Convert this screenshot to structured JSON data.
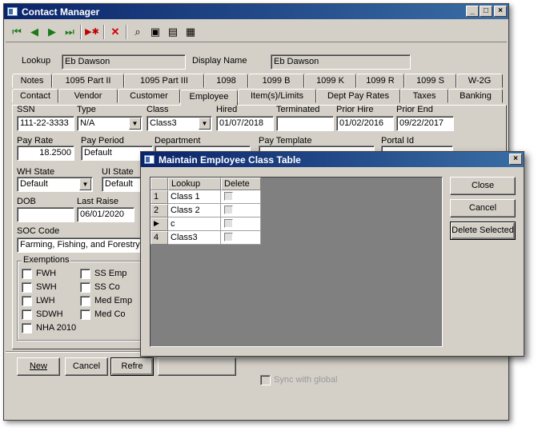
{
  "main_window": {
    "title": "Contact Manager",
    "toolbar": {
      "first_icon": "first-record-icon",
      "prev_icon": "prev-record-icon",
      "next_icon": "next-record-icon",
      "last_icon": "last-record-icon",
      "new_icon": "new-record-icon",
      "delete_icon": "delete-icon",
      "find_icon": "find-icon",
      "save_icon": "save-icon",
      "save_close_icon": "save-close-icon",
      "properties_icon": "properties-icon"
    },
    "lookup_label": "Lookup",
    "lookup_value": "Eb Dawson",
    "display_name_label": "Display Name",
    "display_name_value": "Eb Dawson",
    "tabs_row1": [
      "Notes",
      "1095 Part II",
      "1095 Part III",
      "1098",
      "1099 B",
      "1099 K",
      "1099 R",
      "1099 S",
      "W-2G"
    ],
    "tabs_row2": [
      "Contact",
      "Vendor",
      "Customer",
      "Employee",
      "Item(s)/Limits",
      "Dept Pay Rates",
      "Taxes",
      "Banking"
    ],
    "selected_tab": "Employee",
    "employee": {
      "ssn_label": "SSN",
      "ssn_value": "111-22-3333",
      "type_label": "Type",
      "type_value": "N/A",
      "class_label": "Class",
      "class_value": "Class3",
      "hired_label": "Hired",
      "hired_value": "01/07/2018",
      "terminated_label": "Terminated",
      "terminated_value": "",
      "prior_hire_label": "Prior Hire",
      "prior_hire_value": "01/02/2016",
      "prior_end_label": "Prior End",
      "prior_end_value": "09/22/2017",
      "pay_rate_label": "Pay Rate",
      "pay_rate_value": "18.2500",
      "pay_period_label": "Pay Period",
      "pay_period_value": "Default",
      "department_label": "Department",
      "pay_template_label": "Pay Template",
      "portal_id_label": "Portal Id",
      "wh_state_label": "WH State",
      "wh_state_value": "Default",
      "ui_state_label": "UI State",
      "ui_state_value": "Default",
      "dob_label": "DOB",
      "dob_value": "",
      "last_raise_label": "Last Raise",
      "last_raise_value": "06/01/2020",
      "soc_code_label": "SOC Code",
      "soc_code_value": "Farming, Fishing, and Forestry O",
      "exemptions_label": "Exemptions",
      "exemptions_col1": [
        "FWH",
        "SWH",
        "LWH",
        "SDWH",
        "NHA 2010"
      ],
      "exemptions_col2": [
        "SS Emp",
        "SS Co",
        "Med Emp",
        "Med Co"
      ],
      "sync_label": "Sync with global"
    },
    "buttons": {
      "new": "New",
      "cancel": "Cancel",
      "refresh": "Refre"
    }
  },
  "dialog": {
    "title": "Maintain Employee Class Table",
    "columns": [
      "Lookup",
      "Delete"
    ],
    "rows": [
      {
        "num": "1",
        "lookup": "Class 1",
        "indicator": ""
      },
      {
        "num": "2",
        "lookup": "Class 2",
        "indicator": ""
      },
      {
        "num": "",
        "lookup": "c",
        "indicator": "▶"
      },
      {
        "num": "4",
        "lookup": "Class3",
        "indicator": ""
      }
    ],
    "buttons": {
      "close": "Close",
      "cancel": "Cancel",
      "delete_selected": "Delete Selected"
    }
  }
}
